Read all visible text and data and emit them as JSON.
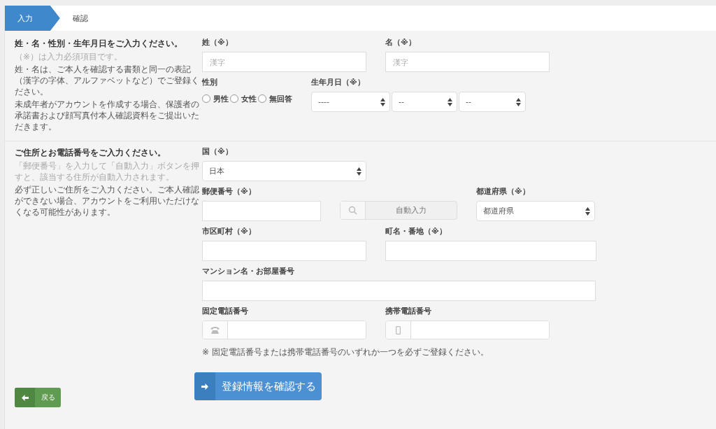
{
  "steps": [
    {
      "label": "入力",
      "selected": true
    },
    {
      "label": "確認",
      "selected": false
    }
  ],
  "sections": [
    {
      "title": "姓・名・性別・生年月日をご入力ください。",
      "notes": [
        {
          "kind": "hint",
          "text": "（※）は入力必須項目です。"
        },
        {
          "kind": "normal",
          "text": "姓・名は、ご本人を確認する書類と同一の表記（漢字の字体、アルファベットなど）でご登録ください。"
        },
        {
          "kind": "normal",
          "text": "未成年者がアカウントを作成する場合、保護者の承諾書および顔写真付本人確認資料をご提出いただきます。"
        }
      ],
      "rows": [
        [
          {
            "kind": "text",
            "label": "姓（※）",
            "placeholder": "漢字"
          },
          {
            "kind": "text",
            "label": "名（※）",
            "placeholder": "漢字"
          }
        ],
        [
          {
            "kind": "radio",
            "label": "性別",
            "options": [
              {
                "label": "男性",
                "selected": false
              },
              {
                "label": "女性",
                "selected": false
              },
              {
                "label": "無回答",
                "selected": false
              }
            ]
          },
          {
            "kind": "date",
            "label": "生年月日（※）",
            "selects": [
              "----",
              "--",
              "--"
            ]
          }
        ]
      ]
    },
    {
      "title": "ご住所とお電話番号をご入力ください。",
      "notes": [
        {
          "kind": "hint",
          "text": "「郵便番号」を入力して「自動入力」ボタンを押すと、該当する住所が自動入力されます。"
        },
        {
          "kind": "normal",
          "text": "必ず正しいご住所をご入力ください。ご本人確認ができない場合、アカウントをご利用いただけなくなる可能性があります。"
        }
      ],
      "rows": [
        [
          {
            "kind": "select",
            "label": "国（※）",
            "value": "日本"
          }
        ],
        [
          {
            "kind": "postal",
            "label": "郵便番号（※）",
            "button": "自動入力"
          },
          {
            "kind": "select_short",
            "label": "都道府県（※）",
            "value": "都道府県"
          }
        ],
        [
          {
            "kind": "text",
            "label": "市区町村（※）"
          },
          {
            "kind": "text_long",
            "label": "町名・番地（※）"
          }
        ],
        [
          {
            "kind": "text_wide",
            "label": "マンション名・お部屋番号"
          }
        ],
        [
          {
            "kind": "phone",
            "label": "固定電話番号"
          },
          {
            "kind": "mobile",
            "label": "携帯電話番号"
          }
        ]
      ],
      "footnote": "※ 固定電話番号または携帯電話番号のいずれか一つを必ずご登録ください。"
    }
  ],
  "back_button": "戻る",
  "submit_button": "登録情報を確認する"
}
